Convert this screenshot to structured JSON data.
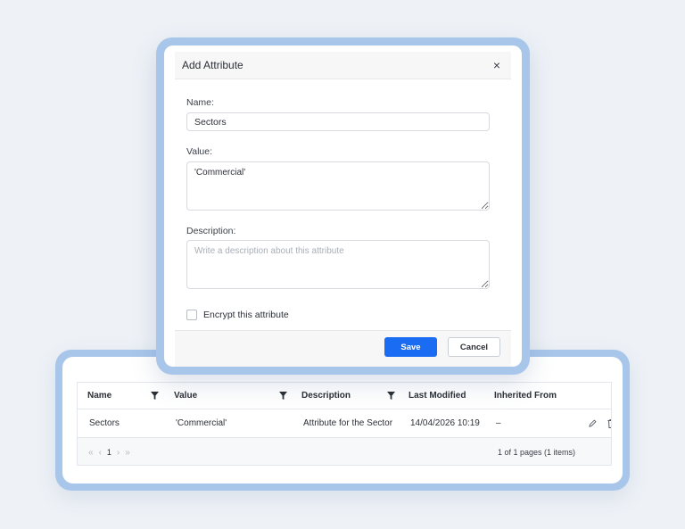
{
  "dialog": {
    "title": "Add Attribute",
    "close_label": "×",
    "name_label": "Name:",
    "name_value": "Sectors",
    "value_label": "Value:",
    "value_value": "'Commercial'",
    "description_label": "Description:",
    "description_placeholder": "Write a description about this attribute",
    "encrypt_label": "Encrypt this attribute",
    "encrypt_checked": false,
    "save_label": "Save",
    "cancel_label": "Cancel"
  },
  "table": {
    "columns": [
      "Name",
      "Value",
      "Description",
      "Last Modified",
      "Inherited From"
    ],
    "filterable_columns": [
      "Name",
      "Value",
      "Description"
    ],
    "rows": [
      {
        "name": "Sectors",
        "value": "'Commercial'",
        "description": "Attribute for the Sector",
        "last_modified": "14/04/2026 10:19",
        "inherited_from": "–"
      }
    ],
    "pager": {
      "first": "«",
      "prev": "‹",
      "page": "1",
      "next": "›",
      "last": "»",
      "info": "1 of 1 pages (1 items)"
    }
  },
  "icons": [
    "filter-icon",
    "edit-icon",
    "delete-icon",
    "close-icon"
  ],
  "colors": {
    "background": "#eef2f7",
    "frame": "#a8c6ea",
    "primary": "#1a6cf2"
  }
}
